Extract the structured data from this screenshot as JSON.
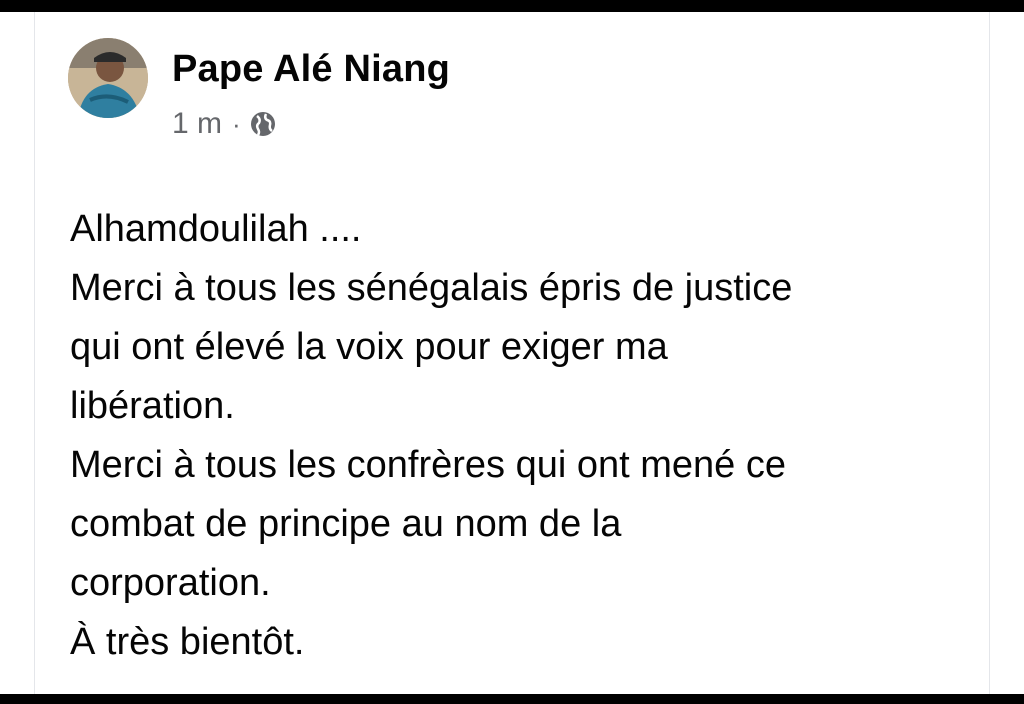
{
  "post": {
    "author": "Pape Alé Niang",
    "time": "1 m",
    "separator": "·",
    "privacy_icon": "globe-icon",
    "lines": [
      "Alhamdoulilah ....",
      "Merci à tous les sénégalais épris de justice",
      "qui ont élevé la voix pour exiger ma",
      "libération.",
      "Merci à tous les confrères qui ont mené ce",
      "combat de principe au nom de la",
      "corporation.",
      "À très bientôt."
    ]
  },
  "colors": {
    "text": "#050505",
    "meta": "#65676b",
    "background": "#ffffff",
    "frame": "#000000"
  }
}
